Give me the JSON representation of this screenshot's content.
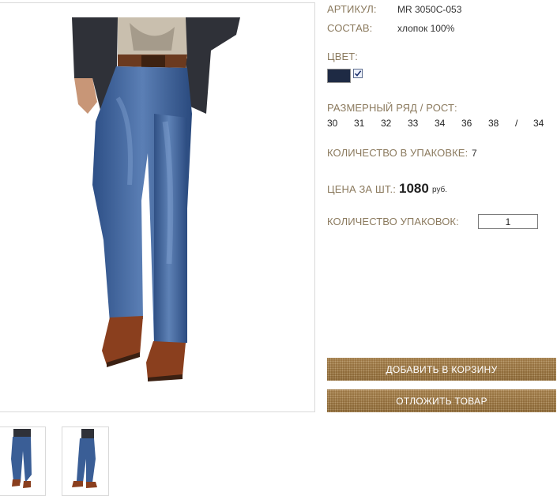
{
  "product": {
    "sku_label": "АРТИКУЛ:",
    "sku_value": "MR 3050C-053",
    "composition_label": "СОСТАВ:",
    "composition_value": "хлопок 100%",
    "color_label": "ЦВЕТ:",
    "colors": [
      {
        "hex": "#1e2a44",
        "selected": true
      }
    ],
    "size_range_label": "РАЗМЕРНЫЙ РЯД / РОСТ:",
    "sizes": [
      "30",
      "31",
      "32",
      "33",
      "34",
      "36",
      "38",
      "/",
      "34"
    ],
    "pack_qty_label": "КОЛИЧЕСТВО В УПАКОВКЕ:",
    "pack_qty_value": "7",
    "price_label": "ЦЕНА ЗА ШТ.:",
    "price_value": "1080",
    "price_unit": "руб.",
    "packs_label": "КОЛИЧЕСТВО УПАКОВОК:",
    "packs_value": "1"
  },
  "actions": {
    "add_to_cart": "ДОБАВИТЬ В КОРЗИНУ",
    "postpone": "ОТЛОЖИТЬ ТОВАР"
  },
  "colors": {
    "label": "#8b7a5e",
    "button": "#8d6a3c"
  }
}
